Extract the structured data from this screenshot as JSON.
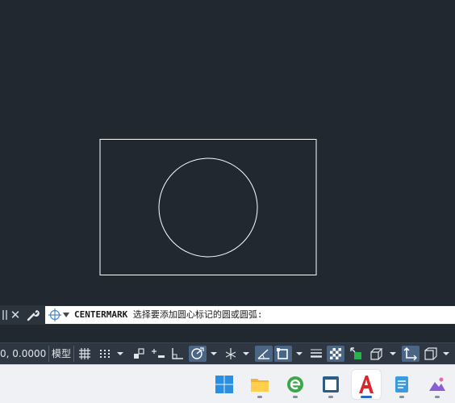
{
  "command_line": {
    "command": "CENTERMARK",
    "prompt": "选择要添加圆心标记的圆或圆弧:"
  },
  "status_bar": {
    "coordinates": "0, 0.0000",
    "model_tab": "模型"
  },
  "colors": {
    "canvas_background": "#212830",
    "drawing_lines": "#ffffff",
    "active_toggle": "#4b6584",
    "command_input_background": "#ffffff"
  },
  "drawing": {
    "objects": [
      "rectangle",
      "circle"
    ]
  },
  "taskbar": {
    "apps": [
      "start-icon",
      "file-explorer-icon",
      "browser-icon",
      "app-window-icon",
      "autocad-icon",
      "notepad-icon",
      "photos-icon"
    ],
    "active_app": "autocad-icon"
  }
}
